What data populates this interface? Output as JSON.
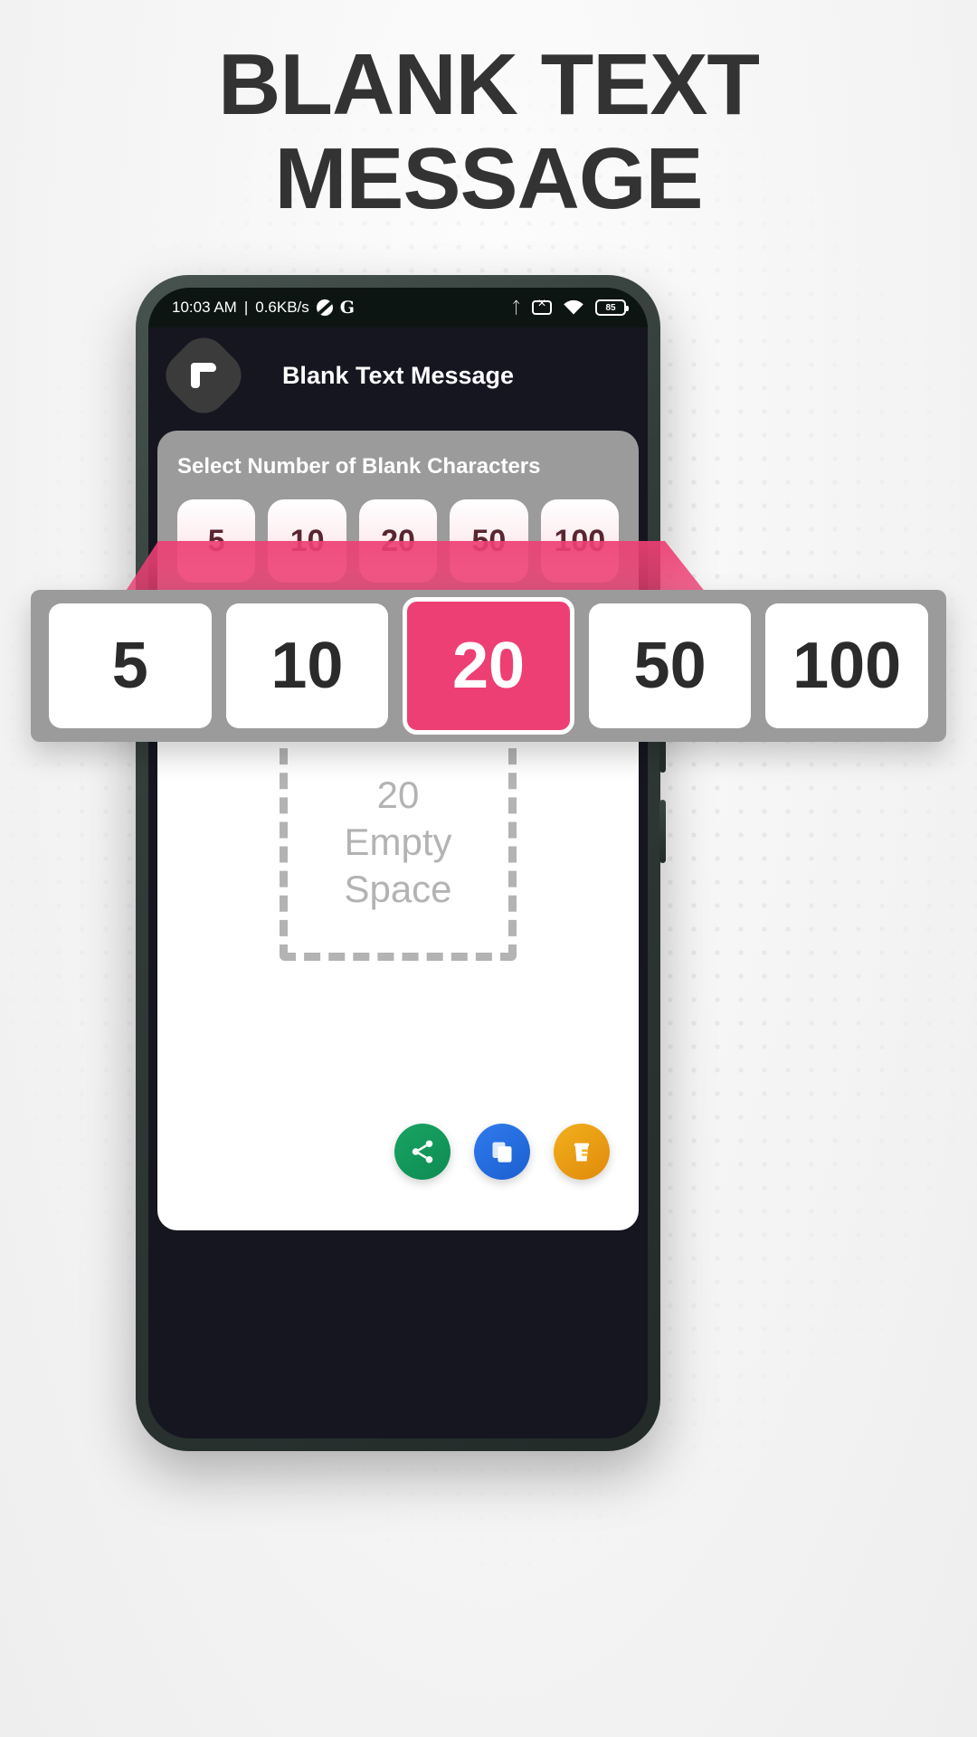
{
  "headline": {
    "line1": "BLANK TEXT",
    "line2": "MESSAGE"
  },
  "colors": {
    "accent_pink": "#EE3F74",
    "panel_gray": "#9B9B9B",
    "headline_gray": "#333333",
    "phone_frame": "#2A332F",
    "screen_dark": "#161621",
    "share_green": "#19A463",
    "copy_blue": "#2F7BED",
    "clear_orange": "#F2B01C",
    "chip_text_maroon": "#5A2630",
    "dashed_gray": "#B3B3B3"
  },
  "phone": {
    "status_bar": {
      "time": "10:03 AM",
      "separator": "|",
      "network_speed": "0.6KB/s",
      "left_icons": [
        "disc-icon",
        "g-icon"
      ],
      "right_icons": [
        "bluetooth-icon",
        "mute-icon",
        "wifi-icon",
        "battery-icon"
      ],
      "battery_level": "85"
    },
    "app_bar": {
      "logo": "app-logo-icon",
      "title": "Blank Text Message"
    },
    "selector": {
      "label": "Select Number of Blank Characters",
      "options": [
        "5",
        "10",
        "20",
        "50",
        "100"
      ],
      "selected": "20"
    },
    "content": {
      "empty_box": {
        "count": "20",
        "line1": "Empty",
        "line2": "Space"
      },
      "actions": [
        {
          "name": "share-button",
          "icon": "share-icon",
          "color": "#19A463"
        },
        {
          "name": "copy-button",
          "icon": "copy-icon",
          "color": "#2F7BED"
        },
        {
          "name": "clear-button",
          "icon": "delete-icon",
          "color": "#F2B01C"
        }
      ]
    }
  },
  "magnified_callout": {
    "options": [
      "5",
      "10",
      "20",
      "50",
      "100"
    ],
    "selected_index": 2,
    "selected_value": "20"
  }
}
